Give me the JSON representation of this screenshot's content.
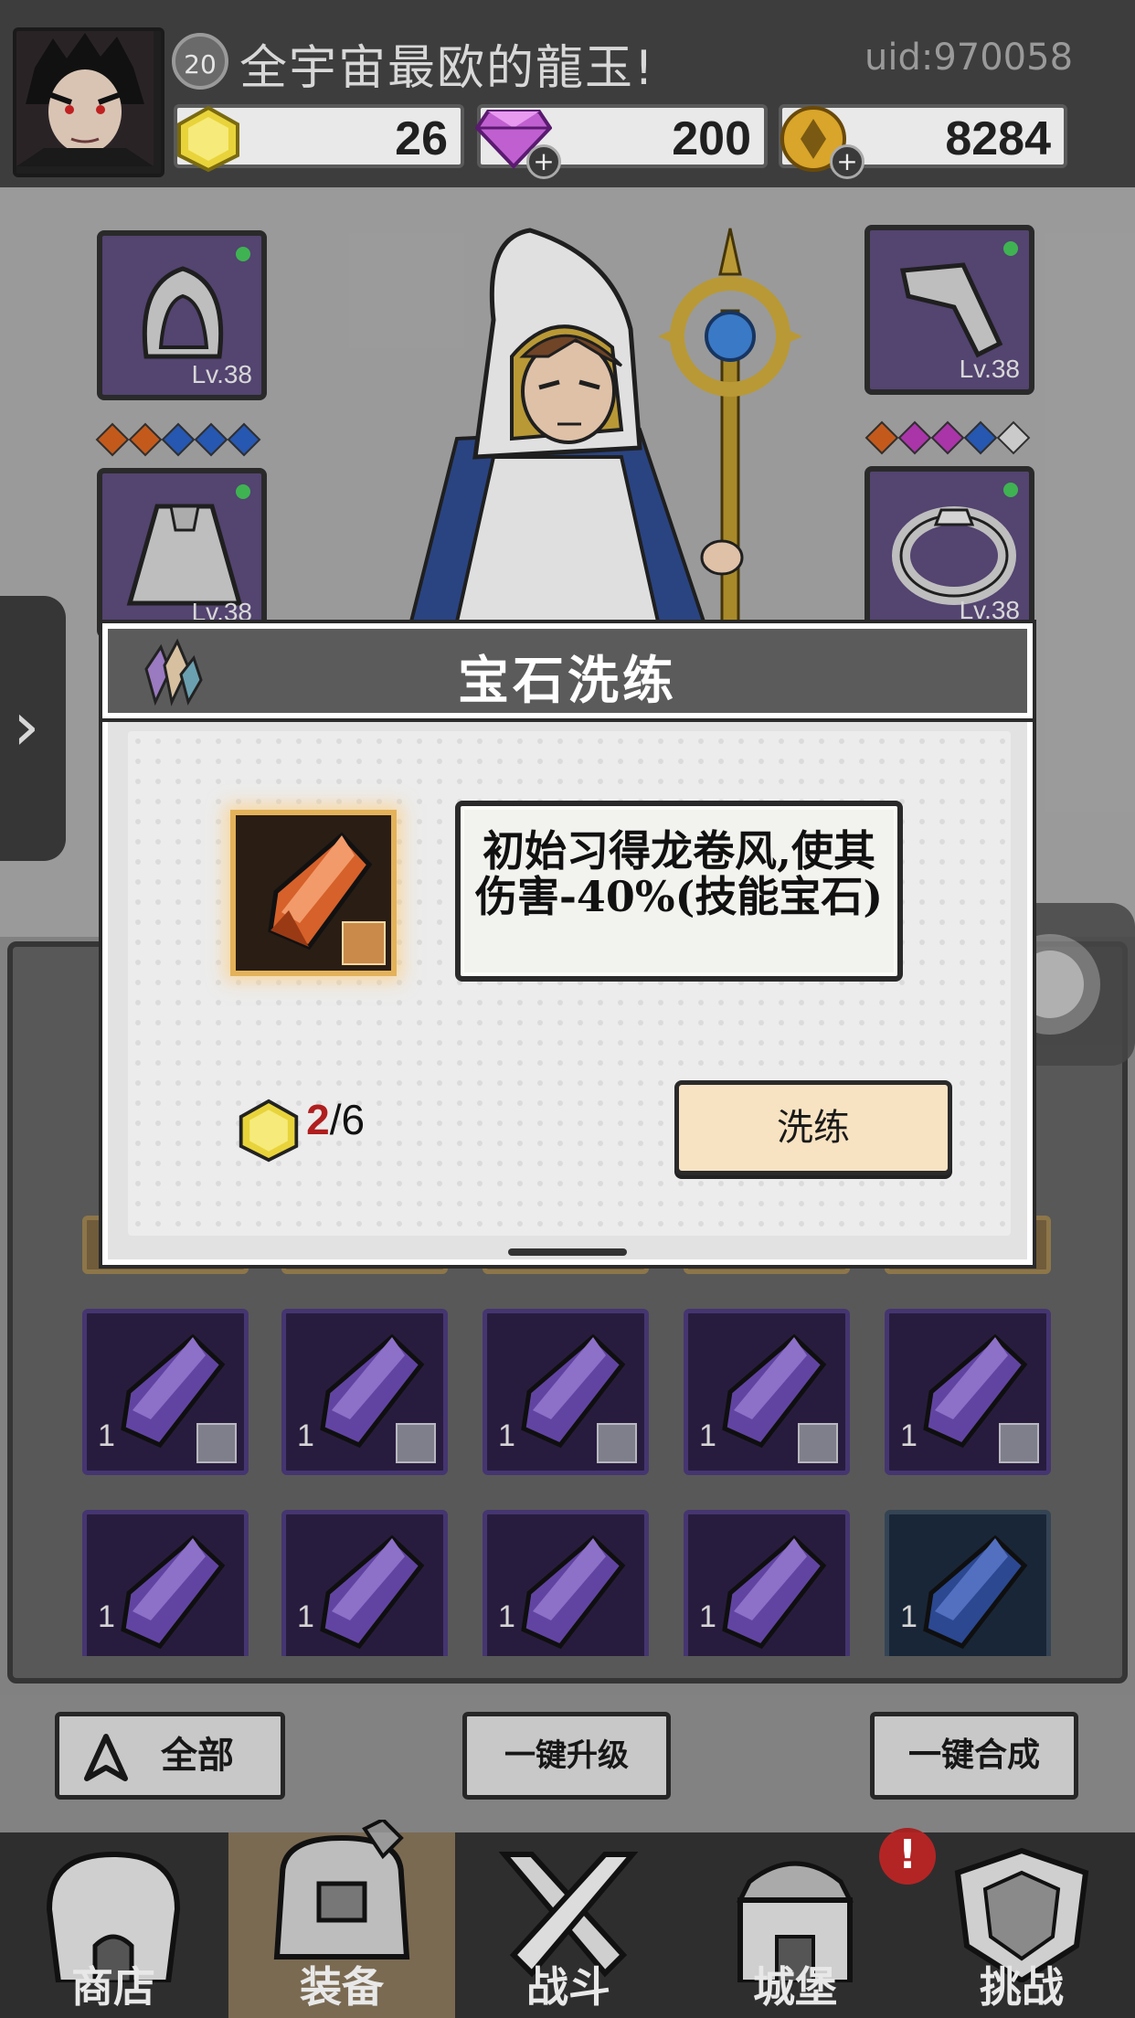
{
  "header": {
    "player_level": "20",
    "player_name": "全宇宙最欧的龍玉!",
    "uid": "uid:970058",
    "resources": [
      {
        "name": "gem-shard",
        "value": "26"
      },
      {
        "name": "diamond",
        "value": "200"
      },
      {
        "name": "gold-coin",
        "value": "8284"
      }
    ]
  },
  "equipment": {
    "slots": [
      {
        "slot": "hood",
        "level": "Lv.38"
      },
      {
        "slot": "gloves",
        "level": "Lv.38"
      },
      {
        "slot": "cloak",
        "level": "Lv.38"
      },
      {
        "slot": "ring",
        "level": "Lv.38"
      }
    ],
    "left_gem_dots": [
      "#d4621e",
      "#d4621e",
      "#2a5fc0",
      "#2a5fc0",
      "#2a5fc0"
    ],
    "right_gem_dots": [
      "#d4621e",
      "#b83ab8",
      "#b83ab8",
      "#2a5fc0",
      "#dcdcdc"
    ]
  },
  "modal": {
    "title": "宝石洗练",
    "description": "初始习得龙卷风,使其伤害-40%(技能宝石)",
    "cost_have": "2",
    "cost_need": "/6",
    "refine_button": "洗练"
  },
  "inventory": {
    "rows": [
      [
        {
          "qty": "1",
          "color": "purple"
        },
        {
          "qty": "1",
          "color": "purple"
        },
        {
          "qty": "1",
          "color": "purple"
        },
        {
          "qty": "1",
          "color": "purple"
        },
        {
          "qty": "1",
          "color": "purple"
        }
      ],
      [
        {
          "qty": "1",
          "color": "purple"
        },
        {
          "qty": "1",
          "color": "purple"
        },
        {
          "qty": "1",
          "color": "purple"
        },
        {
          "qty": "1",
          "color": "purple"
        },
        {
          "qty": "1",
          "color": "blue"
        }
      ]
    ]
  },
  "actions": {
    "filter_label": "全部",
    "upgrade_all": "一键升级",
    "merge_all": "一键合成"
  },
  "nav": [
    {
      "label": "商店",
      "icon": "shop-icon"
    },
    {
      "label": "装备",
      "icon": "backpack-icon"
    },
    {
      "label": "战斗",
      "icon": "crossed-swords-icon"
    },
    {
      "label": "城堡",
      "icon": "castle-icon"
    },
    {
      "label": "挑战",
      "icon": "shield-icon"
    }
  ],
  "notice_badge": "!"
}
